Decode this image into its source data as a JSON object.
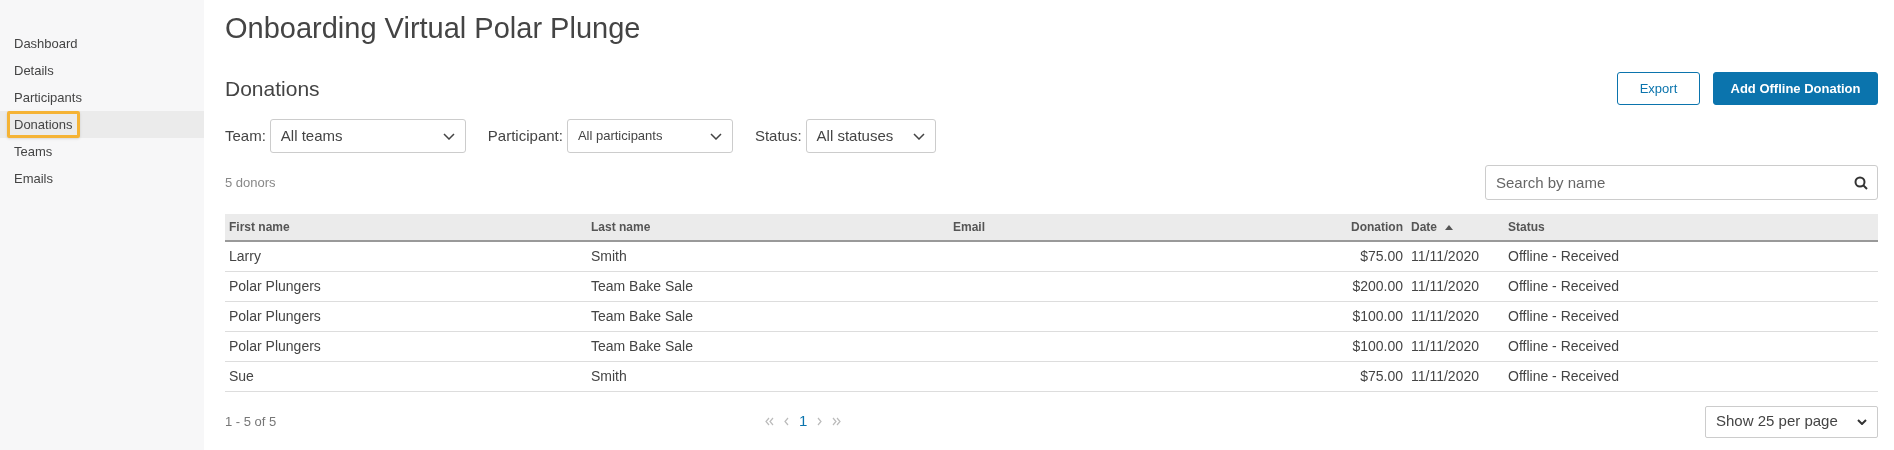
{
  "sidebar": {
    "items": [
      {
        "label": "Dashboard",
        "selected": false
      },
      {
        "label": "Details",
        "selected": false
      },
      {
        "label": "Participants",
        "selected": false
      },
      {
        "label": "Donations",
        "selected": true
      },
      {
        "label": "Teams",
        "selected": false
      },
      {
        "label": "Emails",
        "selected": false
      }
    ]
  },
  "page_title": "Onboarding Virtual Polar Plunge",
  "section_title": "Donations",
  "actions": [
    {
      "label": "Export",
      "kind": "outline"
    },
    {
      "label": "Add Offline Donation",
      "kind": "primary"
    }
  ],
  "filters": [
    {
      "label": "Team:",
      "value": "All teams"
    },
    {
      "label": "Participant:",
      "value": "All participants"
    },
    {
      "label": "Status:",
      "value": "All statuses"
    }
  ],
  "count": "5 donors",
  "search": {
    "placeholder": "Search by name"
  },
  "table": {
    "columns": [
      {
        "label": "First name",
        "kind": "text",
        "sorted": false
      },
      {
        "label": "Last name",
        "kind": "text",
        "sorted": false
      },
      {
        "label": "Email",
        "kind": "text",
        "sorted": false
      },
      {
        "label": "Donation",
        "kind": "amount",
        "sorted": false
      },
      {
        "label": "Date",
        "kind": "text",
        "sorted": true
      },
      {
        "label": "Status",
        "kind": "text",
        "sorted": false
      }
    ],
    "rows": [
      [
        "Larry",
        "Smith",
        "",
        "$75.00",
        "11/11/2020",
        "Offline - Received"
      ],
      [
        "Polar Plungers",
        "Team Bake Sale",
        "",
        "$200.00",
        "11/11/2020",
        "Offline - Received"
      ],
      [
        "Polar Plungers",
        "Team Bake Sale",
        "",
        "$100.00",
        "11/11/2020",
        "Offline - Received"
      ],
      [
        "Polar Plungers",
        "Team Bake Sale",
        "",
        "$100.00",
        "11/11/2020",
        "Offline - Received"
      ],
      [
        "Sue",
        "Smith",
        "",
        "$75.00",
        "11/11/2020",
        "Offline - Received"
      ]
    ]
  },
  "pagination": {
    "range": "1 - 5 of 5",
    "pages": [
      {
        "label": "1",
        "selected": true
      }
    ],
    "per_page": "Show 25 per page"
  }
}
